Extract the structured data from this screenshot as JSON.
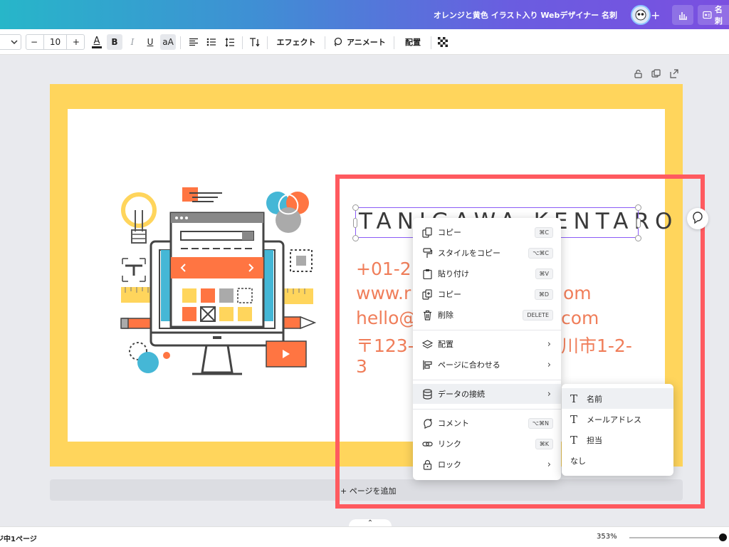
{
  "topbar": {
    "doc_title": "オレンジと黄色 イラスト入り Webデザイナー 名刺",
    "plus": "+",
    "share_label": "名刺"
  },
  "toolbar": {
    "font_size": "10",
    "minus": "−",
    "plus": "+",
    "bold": "B",
    "italic": "I",
    "underline": "U",
    "case": "aA",
    "effect_label": "エフェクト",
    "animate_label": "アニメート",
    "position_label": "配置"
  },
  "card": {
    "name": "TANIGAWA KENTARO",
    "phone": "+01-2",
    "web": "www.r",
    "web_tail": "om",
    "email": "hello@",
    "email_tail": "com",
    "address": "〒123-",
    "address_tail": "川市1-2-",
    "address_line2": "3"
  },
  "add_page": "+ ページを追加",
  "context_menu": {
    "items": [
      {
        "label": "コピー",
        "shortcut": "⌘C",
        "icon": "copy-icon"
      },
      {
        "label": "スタイルをコピー",
        "shortcut": "⌥⌘C",
        "icon": "paint-roller-icon"
      },
      {
        "label": "貼り付け",
        "shortcut": "⌘V",
        "icon": "clipboard-icon"
      },
      {
        "label": "コピー",
        "shortcut": "⌘D",
        "icon": "duplicate-icon"
      },
      {
        "label": "削除",
        "shortcut": "DELETE",
        "icon": "trash-icon"
      },
      {
        "label": "配置",
        "icon": "layers-icon"
      },
      {
        "label": "ページに合わせる",
        "icon": "align-icon"
      },
      {
        "label": "データの接続",
        "icon": "database-icon"
      },
      {
        "label": "コメント",
        "shortcut": "⌥⌘N",
        "icon": "comment-icon"
      },
      {
        "label": "リンク",
        "shortcut": "⌘K",
        "icon": "link-icon"
      },
      {
        "label": "ロック",
        "icon": "lock-icon"
      }
    ]
  },
  "submenu": {
    "items": [
      {
        "label": "名前"
      },
      {
        "label": "メールアドレス"
      },
      {
        "label": "担当"
      },
      {
        "label": "なし"
      }
    ]
  },
  "bottombar": {
    "page_count": "ジ中1ページ",
    "zoom": "353%",
    "collapse": "⌃"
  }
}
